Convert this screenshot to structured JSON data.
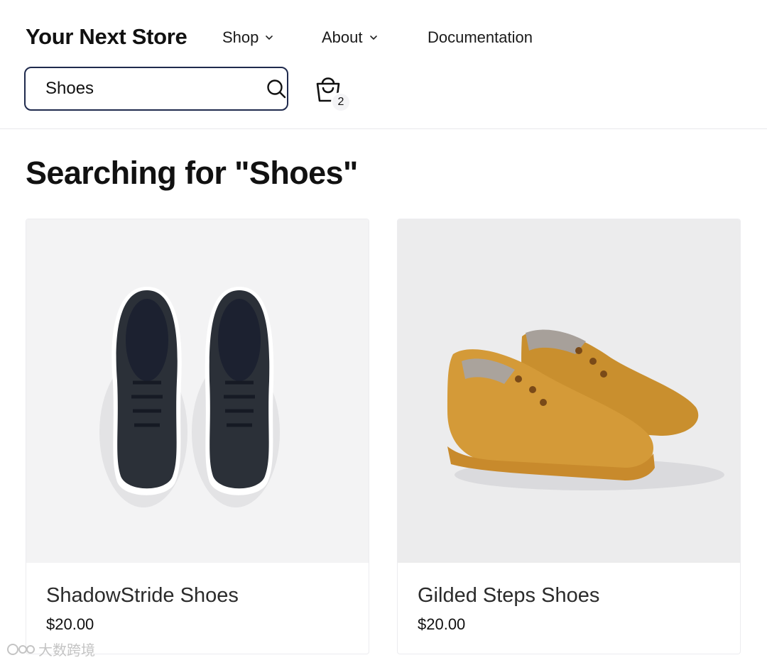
{
  "store": {
    "name": "Your Next Store"
  },
  "nav": {
    "items": [
      {
        "label": "Shop"
      },
      {
        "label": "About"
      },
      {
        "label": "Documentation"
      }
    ]
  },
  "search": {
    "value": "Shoes"
  },
  "cart": {
    "count": "2"
  },
  "page": {
    "heading": "Searching for \"Shoes\""
  },
  "products": [
    {
      "name": "ShadowStride Shoes",
      "price": "$20.00",
      "image_icon": "black-sneakers-image",
      "bg": "#f3f3f4"
    },
    {
      "name": "Gilded Steps Shoes",
      "price": "$20.00",
      "image_icon": "tan-sneakers-image",
      "bg": "#ececed"
    }
  ],
  "watermark": {
    "text": "大数跨境"
  },
  "colors": {
    "search_border": "#1f2a4d",
    "text": "#111111"
  }
}
